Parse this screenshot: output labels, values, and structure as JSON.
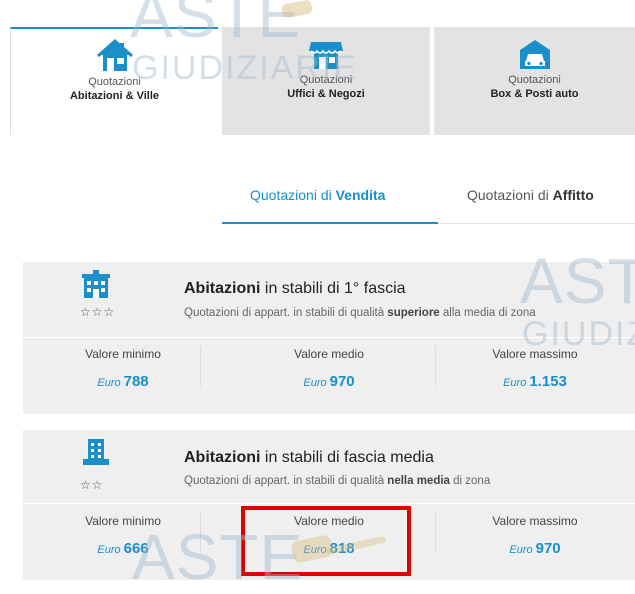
{
  "category_tabs": [
    {
      "line1": "Quotazioni",
      "line2": "Abitazioni & Ville",
      "icon": "house-icon"
    },
    {
      "line1": "Quotazioni",
      "line2": "Uffici & Negozi",
      "icon": "shop-icon"
    },
    {
      "line1": "Quotazioni",
      "line2": "Box & Posti auto",
      "icon": "garage-car-icon"
    }
  ],
  "sub_tabs": {
    "sale_prefix": "Quotazioni di ",
    "sale_bold": "Vendita",
    "rent_prefix": "Quotazioni di ",
    "rent_bold": "Affitto"
  },
  "cards": [
    {
      "title_bold": "Abitazioni",
      "title_rest": " in stabili di 1° fascia",
      "desc_pre": "Quotazioni di appart. in stabili di qualità ",
      "desc_bold": "superiore",
      "desc_post": " alla media di zona",
      "stars": "☆☆☆",
      "columns": [
        {
          "label": "Valore minimo",
          "currency": "Euro",
          "value": "788"
        },
        {
          "label": "Valore medio",
          "currency": "Euro",
          "value": "970"
        },
        {
          "label": "Valore massimo",
          "currency": "Euro",
          "value": "1.153"
        }
      ]
    },
    {
      "title_bold": "Abitazioni",
      "title_rest": " in stabili di fascia media",
      "desc_pre": "Quotazioni di appart. in stabili di qualità ",
      "desc_bold": "nella media",
      "desc_post": " di zona",
      "stars": "☆☆",
      "columns": [
        {
          "label": "Valore minimo",
          "currency": "Euro",
          "value": "666"
        },
        {
          "label": "Valore medio",
          "currency": "Euro",
          "value": "818"
        },
        {
          "label": "Valore massimo",
          "currency": "Euro",
          "value": "970"
        }
      ]
    }
  ],
  "watermark": {
    "line1": "ASTE",
    "line2": "GIUDIZIARIE",
    "registered": "®"
  },
  "colors": {
    "accent": "#1a8fc9",
    "card_bg": "#efefef",
    "inactive_tab": "#e3e3e3",
    "highlight": "#e00000"
  }
}
